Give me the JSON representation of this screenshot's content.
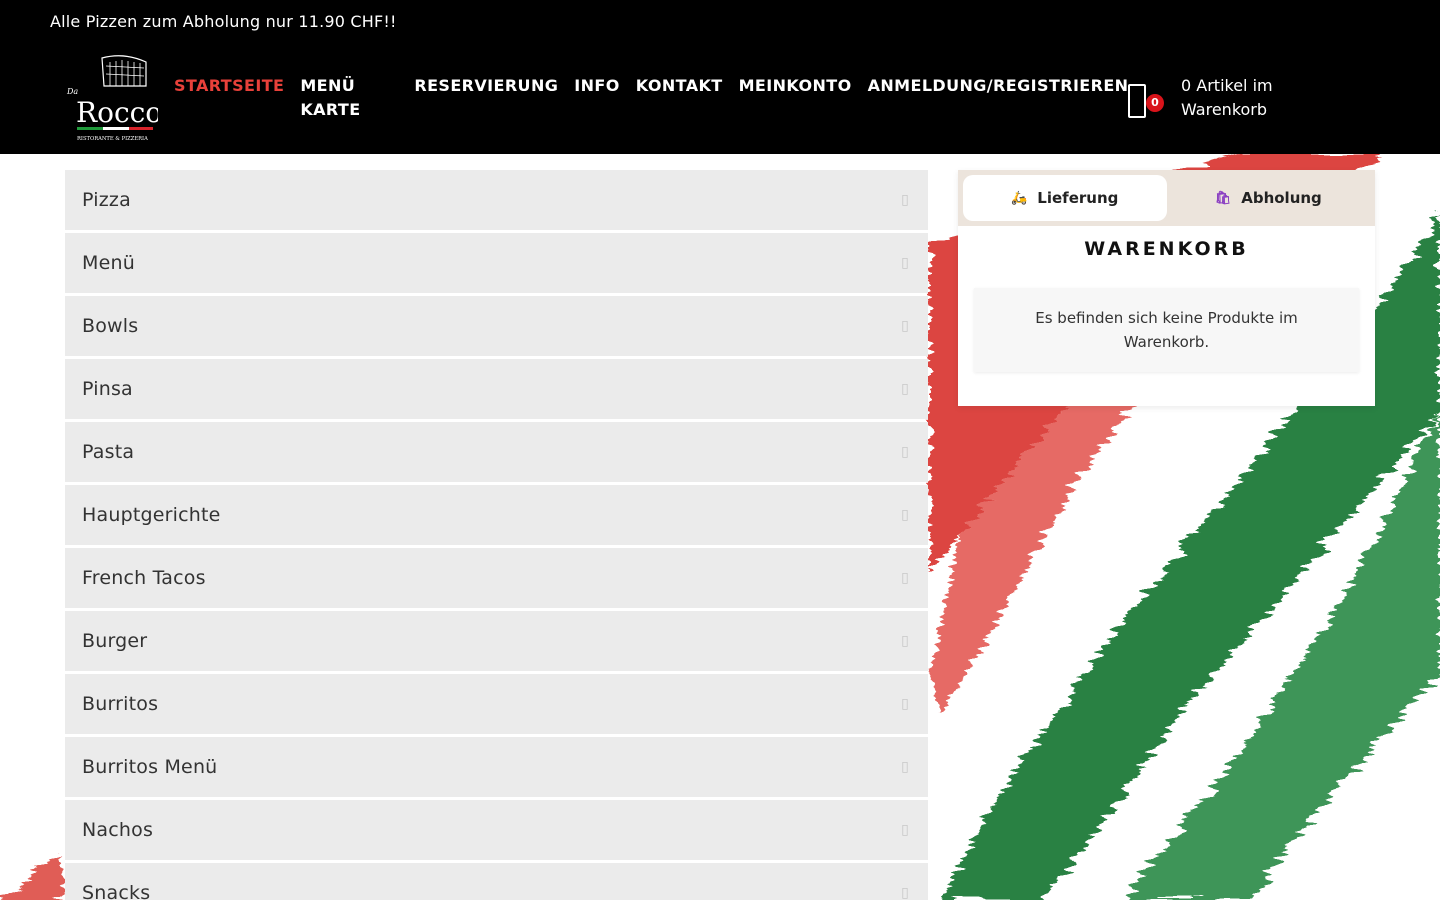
{
  "promo": {
    "text": "Alle Pizzen zum Abholung nur 11.90 CHF!!"
  },
  "logo": {
    "prefix": "Da",
    "name": "Rocco",
    "tagline": "RISTORANTE & PIZZERIA"
  },
  "nav": {
    "items": [
      {
        "label": "STARTSEITE",
        "active": true
      },
      {
        "label": "MENÜ KARTE"
      },
      {
        "label": "RESERVIERUNG"
      },
      {
        "label": "INFO"
      },
      {
        "label": "KONTAKT"
      },
      {
        "label": "MEINKONTO"
      },
      {
        "label": "ANMELDUNG/REGISTRIEREN"
      }
    ]
  },
  "mini_cart": {
    "count": "0",
    "text": "0 Artikel im Warenkorb"
  },
  "categories": [
    "Pizza",
    "Menü",
    "Bowls",
    "Pinsa",
    "Pasta",
    "Hauptgerichte",
    "French Tacos",
    "Burger",
    "Burritos",
    "Burritos Menü",
    "Nachos",
    "Snacks"
  ],
  "cart_panel": {
    "tabs": [
      {
        "label": "Lieferung",
        "icon": "scooter-icon",
        "active": true
      },
      {
        "label": "Abholung",
        "icon": "shopping-bag-icon"
      }
    ],
    "title": "WARENKORB",
    "empty_message": "Es befinden sich keine Produkte im Warenkorb."
  },
  "colors": {
    "accent": "#e8413a",
    "badge": "#d9131a",
    "flag_green": "#1f7a3a",
    "flag_red": "#d8322b"
  }
}
